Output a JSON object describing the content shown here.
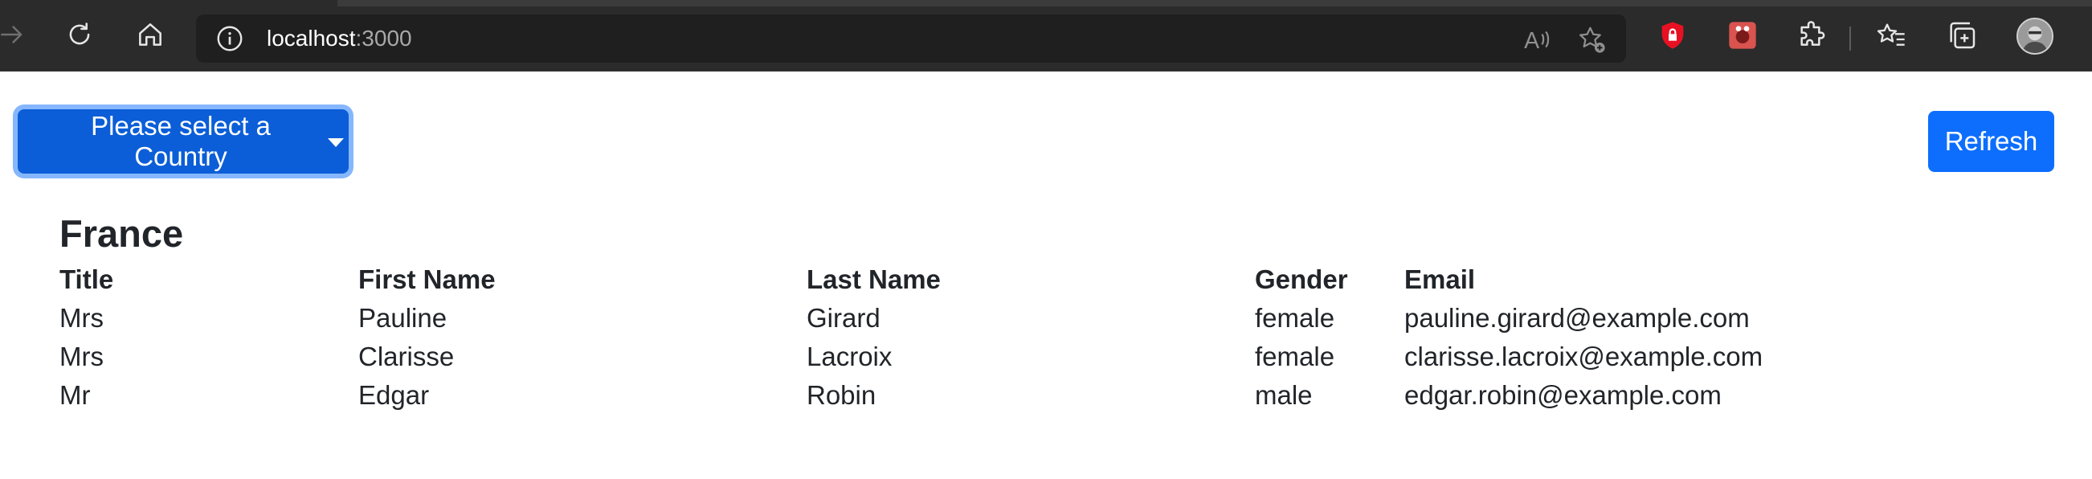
{
  "browser": {
    "url_host": "localhost",
    "url_port": ":3000",
    "icons": {
      "forward": "forward-arrow-icon",
      "reload": "reload-icon",
      "home": "home-icon",
      "site_info": "info-icon",
      "read_aloud": "read-aloud-icon",
      "favorite_add": "add-favorite-icon",
      "ext1": "red-shield-extension-icon",
      "ext2": "red-bug-extension-icon",
      "extensions": "puzzle-icon",
      "favorites": "favorites-icon",
      "collections": "collections-icon",
      "profile": "profile-avatar"
    },
    "colors": {
      "chrome_bg": "#2b2b2b",
      "urlbar_bg": "#1f1f1f"
    }
  },
  "toolbar": {
    "country_select_label": "Please select a Country",
    "refresh_label": "Refresh",
    "accent": "#0d6efd"
  },
  "main": {
    "country_name": "France",
    "table": {
      "headers": [
        "Title",
        "First Name",
        "Last Name",
        "Gender",
        "Email"
      ],
      "rows": [
        [
          "Mrs",
          "Pauline",
          "Girard",
          "female",
          "pauline.girard@example.com"
        ],
        [
          "Mrs",
          "Clarisse",
          "Lacroix",
          "female",
          "clarisse.lacroix@example.com"
        ],
        [
          "Mr",
          "Edgar",
          "Robin",
          "male",
          "edgar.robin@example.com"
        ]
      ]
    }
  }
}
